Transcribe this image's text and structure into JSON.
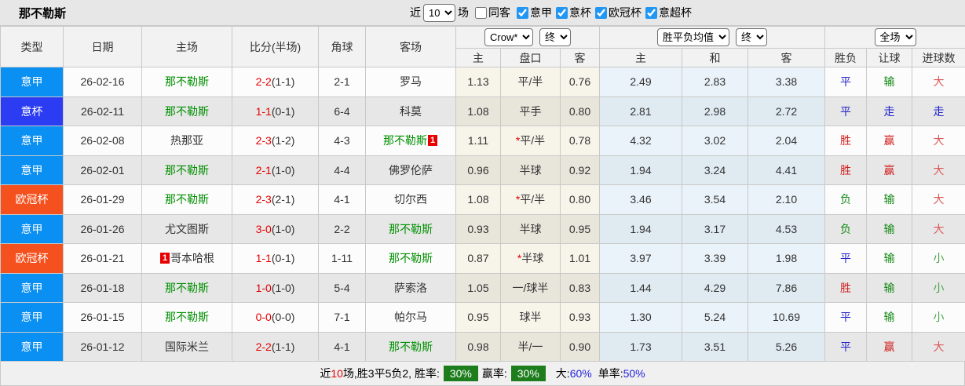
{
  "title": "那不勒斯",
  "filter_bar": {
    "recent_label": "近",
    "recent_value": "10",
    "games_label": "场",
    "same_away_label": "同客",
    "same_away_checked": false,
    "leagues": [
      {
        "label": "意甲",
        "checked": true
      },
      {
        "label": "意杯",
        "checked": true
      },
      {
        "label": "欧冠杯",
        "checked": true
      },
      {
        "label": "意超杯",
        "checked": true
      }
    ]
  },
  "table_header": {
    "cols": [
      "类型",
      "日期",
      "主场",
      "比分(半场)",
      "角球",
      "客场"
    ],
    "handicap": {
      "bookmaker": "Crow*",
      "stage": "终",
      "sub": [
        "主",
        "盘口",
        "客"
      ]
    },
    "euro": {
      "bookmaker": "胜平负均值",
      "stage": "终",
      "sub": [
        "主",
        "和",
        "客"
      ]
    },
    "result": {
      "scope": "全场",
      "sub": [
        "胜负",
        "让球",
        "进球数"
      ]
    }
  },
  "league_colors": {
    "意甲": "#0a8ff2",
    "意杯": "#2b3cf2",
    "欧冠杯": "#f4511e"
  },
  "rows": [
    {
      "type": "意甲",
      "date": "26-02-16",
      "home": {
        "name": "那不勒斯",
        "green": true,
        "badge": "",
        "badge_pos": ""
      },
      "score": "2-2",
      "half": "(1-1)",
      "corners": "2-1",
      "away": {
        "name": "罗马",
        "green": false,
        "badge": "",
        "badge_pos": ""
      },
      "ah": {
        "home": "1.13",
        "star": "",
        "line": "平/半",
        "away": "0.76"
      },
      "euro": {
        "home": "2.49",
        "draw": "2.83",
        "away": "3.38"
      },
      "result": {
        "text": "平",
        "class": "draw"
      },
      "handicap_result": {
        "text": "输",
        "class": "lose"
      },
      "goals": {
        "text": "大",
        "class": "big"
      }
    },
    {
      "type": "意杯",
      "date": "26-02-11",
      "home": {
        "name": "那不勒斯",
        "green": true,
        "badge": "",
        "badge_pos": ""
      },
      "score": "1-1",
      "half": "(0-1)",
      "corners": "6-4",
      "away": {
        "name": "科莫",
        "green": false,
        "badge": "",
        "badge_pos": ""
      },
      "ah": {
        "home": "1.08",
        "star": "",
        "line": "平手",
        "away": "0.80"
      },
      "euro": {
        "home": "2.81",
        "draw": "2.98",
        "away": "2.72"
      },
      "result": {
        "text": "平",
        "class": "draw"
      },
      "handicap_result": {
        "text": "走",
        "class": "void"
      },
      "goals": {
        "text": "走",
        "class": "void"
      }
    },
    {
      "type": "意甲",
      "date": "26-02-08",
      "home": {
        "name": "热那亚",
        "green": false,
        "badge": "",
        "badge_pos": ""
      },
      "score": "2-3",
      "half": "(1-2)",
      "corners": "4-3",
      "away": {
        "name": "那不勒斯",
        "green": true,
        "badge": "1",
        "badge_pos": "after"
      },
      "ah": {
        "home": "1.11",
        "star": "*",
        "line": "平/半",
        "away": "0.78"
      },
      "euro": {
        "home": "4.32",
        "draw": "3.02",
        "away": "2.04"
      },
      "result": {
        "text": "胜",
        "class": "win"
      },
      "handicap_result": {
        "text": "赢",
        "class": "win"
      },
      "goals": {
        "text": "大",
        "class": "big"
      }
    },
    {
      "type": "意甲",
      "date": "26-02-01",
      "home": {
        "name": "那不勒斯",
        "green": true,
        "badge": "",
        "badge_pos": ""
      },
      "score": "2-1",
      "half": "(1-0)",
      "corners": "4-4",
      "away": {
        "name": "佛罗伦萨",
        "green": false,
        "badge": "",
        "badge_pos": ""
      },
      "ah": {
        "home": "0.96",
        "star": "",
        "line": "半球",
        "away": "0.92"
      },
      "euro": {
        "home": "1.94",
        "draw": "3.24",
        "away": "4.41"
      },
      "result": {
        "text": "胜",
        "class": "win"
      },
      "handicap_result": {
        "text": "赢",
        "class": "win"
      },
      "goals": {
        "text": "大",
        "class": "big"
      }
    },
    {
      "type": "欧冠杯",
      "date": "26-01-29",
      "home": {
        "name": "那不勒斯",
        "green": true,
        "badge": "",
        "badge_pos": ""
      },
      "score": "2-3",
      "half": "(2-1)",
      "corners": "4-1",
      "away": {
        "name": "切尔西",
        "green": false,
        "badge": "",
        "badge_pos": ""
      },
      "ah": {
        "home": "1.08",
        "star": "*",
        "line": "平/半",
        "away": "0.80"
      },
      "euro": {
        "home": "3.46",
        "draw": "3.54",
        "away": "2.10"
      },
      "result": {
        "text": "负",
        "class": "lose"
      },
      "handicap_result": {
        "text": "输",
        "class": "lose"
      },
      "goals": {
        "text": "大",
        "class": "big"
      }
    },
    {
      "type": "意甲",
      "date": "26-01-26",
      "home": {
        "name": "尤文图斯",
        "green": false,
        "badge": "",
        "badge_pos": ""
      },
      "score": "3-0",
      "half": "(1-0)",
      "corners": "2-2",
      "away": {
        "name": "那不勒斯",
        "green": true,
        "badge": "",
        "badge_pos": ""
      },
      "ah": {
        "home": "0.93",
        "star": "",
        "line": "半球",
        "away": "0.95"
      },
      "euro": {
        "home": "1.94",
        "draw": "3.17",
        "away": "4.53"
      },
      "result": {
        "text": "负",
        "class": "lose"
      },
      "handicap_result": {
        "text": "输",
        "class": "lose"
      },
      "goals": {
        "text": "大",
        "class": "big"
      }
    },
    {
      "type": "欧冠杯",
      "date": "26-01-21",
      "home": {
        "name": "哥本哈根",
        "green": false,
        "badge": "1",
        "badge_pos": "before"
      },
      "score": "1-1",
      "half": "(0-1)",
      "corners": "1-11",
      "away": {
        "name": "那不勒斯",
        "green": true,
        "badge": "",
        "badge_pos": ""
      },
      "ah": {
        "home": "0.87",
        "star": "*",
        "line": "半球",
        "away": "1.01"
      },
      "euro": {
        "home": "3.97",
        "draw": "3.39",
        "away": "1.98"
      },
      "result": {
        "text": "平",
        "class": "draw"
      },
      "handicap_result": {
        "text": "输",
        "class": "lose"
      },
      "goals": {
        "text": "小",
        "class": "small"
      }
    },
    {
      "type": "意甲",
      "date": "26-01-18",
      "home": {
        "name": "那不勒斯",
        "green": true,
        "badge": "",
        "badge_pos": ""
      },
      "score": "1-0",
      "half": "(1-0)",
      "corners": "5-4",
      "away": {
        "name": "萨索洛",
        "green": false,
        "badge": "",
        "badge_pos": ""
      },
      "ah": {
        "home": "1.05",
        "star": "",
        "line": "一/球半",
        "away": "0.83"
      },
      "euro": {
        "home": "1.44",
        "draw": "4.29",
        "away": "7.86"
      },
      "result": {
        "text": "胜",
        "class": "win"
      },
      "handicap_result": {
        "text": "输",
        "class": "lose"
      },
      "goals": {
        "text": "小",
        "class": "small"
      }
    },
    {
      "type": "意甲",
      "date": "26-01-15",
      "home": {
        "name": "那不勒斯",
        "green": true,
        "badge": "",
        "badge_pos": ""
      },
      "score": "0-0",
      "half": "(0-0)",
      "corners": "7-1",
      "away": {
        "name": "帕尔马",
        "green": false,
        "badge": "",
        "badge_pos": ""
      },
      "ah": {
        "home": "0.95",
        "star": "",
        "line": "球半",
        "away": "0.93"
      },
      "euro": {
        "home": "1.30",
        "draw": "5.24",
        "away": "10.69"
      },
      "result": {
        "text": "平",
        "class": "draw"
      },
      "handicap_result": {
        "text": "输",
        "class": "lose"
      },
      "goals": {
        "text": "小",
        "class": "small"
      }
    },
    {
      "type": "意甲",
      "date": "26-01-12",
      "home": {
        "name": "国际米兰",
        "green": false,
        "badge": "",
        "badge_pos": ""
      },
      "score": "2-2",
      "half": "(1-1)",
      "corners": "4-1",
      "away": {
        "name": "那不勒斯",
        "green": true,
        "badge": "",
        "badge_pos": ""
      },
      "ah": {
        "home": "0.98",
        "star": "",
        "line": "半/一",
        "away": "0.90"
      },
      "euro": {
        "home": "1.73",
        "draw": "3.51",
        "away": "5.26"
      },
      "result": {
        "text": "平",
        "class": "draw"
      },
      "handicap_result": {
        "text": "赢",
        "class": "win"
      },
      "goals": {
        "text": "大",
        "class": "big"
      }
    }
  ],
  "footer": {
    "recent_label": "近",
    "recent_count": "10",
    "record_text": "场,胜3平5负2, 胜率:",
    "rate1_value": "30%",
    "rate2_label": "赢率:",
    "rate2_value": "30%",
    "big_label": "大:",
    "big_value": "60%",
    "single_label": "单率:",
    "single_value": "50%"
  },
  "colors": {
    "win_red": "#d32020",
    "draw_blue": "#2222cc",
    "lose_green": "#128812",
    "big_red": "#db5858",
    "small_green": "#4aa44a",
    "rate_badge_green": "#1d7d1d",
    "checkbox_blue": "#2196f3"
  }
}
